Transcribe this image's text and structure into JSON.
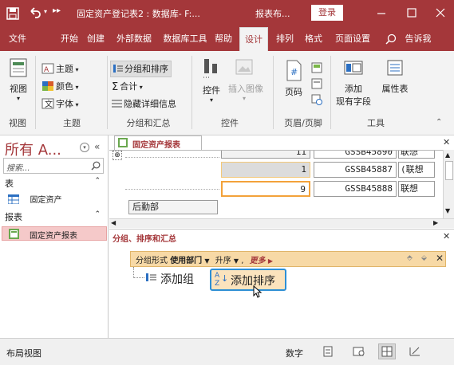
{
  "titlebar": {
    "title": "固定资产登记表2 : 数据库- F:...",
    "context_tab": "报表布...",
    "login": "登录",
    "quick_access": [
      "save",
      "undo",
      "more"
    ]
  },
  "tabs": [
    "文件",
    "开始",
    "创建",
    "外部数据",
    "数据库工具",
    "帮助",
    "设计",
    "排列",
    "格式",
    "页面设置",
    "告诉我"
  ],
  "ribbon": {
    "view": {
      "button": "视图",
      "group": "视图"
    },
    "theme": {
      "themes": "主题",
      "colors": "颜色",
      "fonts": "字体",
      "group": "主题"
    },
    "grouping": {
      "group_sort": "分组和排序",
      "totals": "合计",
      "hide_details": "隐藏详细信息",
      "group": "分组和汇总"
    },
    "controls": {
      "controls": "控件",
      "insert_image": "插入图像",
      "group": "控件"
    },
    "header_footer": {
      "page_number": "页码",
      "group": "页眉/页脚"
    },
    "tools": {
      "add_fields": "添加\n现有字段",
      "add_fields_l1": "添加",
      "add_fields_l2": "现有字段",
      "property_sheet": "属性表",
      "group": "工具"
    }
  },
  "nav": {
    "title": "所有 A...",
    "search_placeholder": "搜索...",
    "sections": [
      {
        "name": "表",
        "items": [
          "固定资产"
        ]
      },
      {
        "name": "报表",
        "items": [
          "固定资产报表"
        ]
      }
    ]
  },
  "report": {
    "tab_title": "固定资产报表",
    "rows": [
      {
        "num": "11",
        "code": "GSSB45890",
        "name": "联想"
      },
      {
        "num": "1",
        "code": "GSSB45887",
        "name": "(联想"
      },
      {
        "num": "9",
        "code": "GSSB45888",
        "name": "联想"
      }
    ],
    "page_footer": "后勤部"
  },
  "group_pane": {
    "title": "分组、排序和汇总",
    "group_by_prefix": "分组形式",
    "group_by_field": "使用部门",
    "sort_order": "升序",
    "more": "更多",
    "add_group": "添加组",
    "add_sort": "添加排序"
  },
  "status": {
    "left": "布局视图",
    "num": "数字"
  },
  "colors": {
    "brand": "#a4373a",
    "highlight": "#f3c97a",
    "selection_blue": "#2d8fd5"
  }
}
